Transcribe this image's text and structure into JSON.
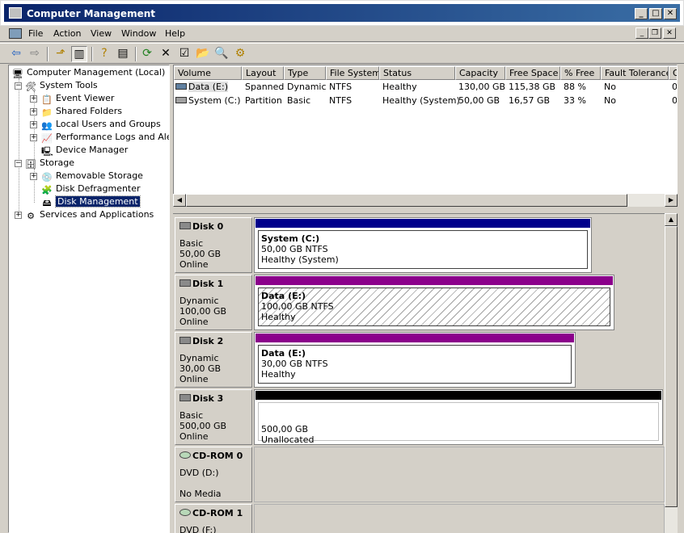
{
  "window": {
    "title": "Computer Management"
  },
  "menu": [
    "File",
    "Action",
    "View",
    "Window",
    "Help"
  ],
  "tree": {
    "root": "Computer Management (Local)",
    "system_tools": "System Tools",
    "event_viewer": "Event Viewer",
    "shared_folders": "Shared Folders",
    "local_users": "Local Users and Groups",
    "perf_logs": "Performance Logs and Alerts",
    "device_manager": "Device Manager",
    "storage": "Storage",
    "removable_storage": "Removable Storage",
    "disk_defrag": "Disk Defragmenter",
    "disk_management": "Disk Management",
    "services": "Services and Applications"
  },
  "volumes": {
    "headers": [
      "Volume",
      "Layout",
      "Type",
      "File System",
      "Status",
      "Capacity",
      "Free Space",
      "% Free",
      "Fault Tolerance",
      "O"
    ],
    "rows": [
      [
        "Data (E:)",
        "Spanned",
        "Dynamic",
        "NTFS",
        "Healthy",
        "130,00 GB",
        "115,38 GB",
        "88 %",
        "No",
        "0"
      ],
      [
        "System (C:)",
        "Partition",
        "Basic",
        "NTFS",
        "Healthy (System)",
        "50,00 GB",
        "16,57 GB",
        "33 %",
        "No",
        "0"
      ]
    ]
  },
  "disks": [
    {
      "name": "Disk 0",
      "kind": "Basic",
      "size": "50,00 GB",
      "status": "Online",
      "part_title": "System  (C:)",
      "part_size": "50,00 GB NTFS",
      "part_status": "Healthy (System)",
      "stripe": "#00008b"
    },
    {
      "name": "Disk 1",
      "kind": "Dynamic",
      "size": "100,00 GB",
      "status": "Online",
      "part_title": "Data  (E:)",
      "part_size": "100,00 GB NTFS",
      "part_status": "Healthy",
      "stripe": "#8b008b"
    },
    {
      "name": "Disk 2",
      "kind": "Dynamic",
      "size": "30,00 GB",
      "status": "Online",
      "part_title": "Data  (E:)",
      "part_size": "30,00 GB NTFS",
      "part_status": "Healthy",
      "stripe": "#8b008b"
    },
    {
      "name": "Disk 3",
      "kind": "Basic",
      "size": "500,00 GB",
      "status": "Online",
      "part_title": "",
      "part_size": "500,00 GB",
      "part_status": "Unallocated",
      "stripe": "#000000"
    }
  ],
  "cdroms": [
    {
      "name": "CD-ROM 0",
      "drive": "DVD (D:)",
      "media": "No Media"
    },
    {
      "name": "CD-ROM 1",
      "drive": "DVD (F:)",
      "media": ""
    }
  ]
}
